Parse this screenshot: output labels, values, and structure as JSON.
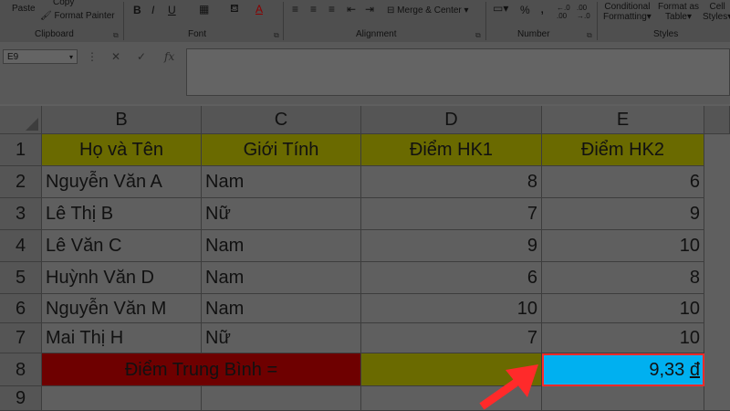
{
  "ribbon": {
    "clipboard": {
      "paste": "Paste",
      "copy": "Copy",
      "format_painter": "Format Painter",
      "group": "Clipboard"
    },
    "font": {
      "bold": "B",
      "italic": "I",
      "underline": "U",
      "font_color": "A",
      "group": "Font"
    },
    "alignment": {
      "merge_center": "Merge & Center",
      "group": "Alignment"
    },
    "number": {
      "percent": "%",
      "comma": ",",
      "group": "Number"
    },
    "styles": {
      "conditional_1": "Conditional",
      "conditional_2": "Formatting",
      "format_table_1": "Format as",
      "format_table_2": "Table",
      "cell_styles_1": "Cell",
      "cell_styles_2": "Styles",
      "group": "Styles"
    }
  },
  "formula_bar": {
    "name_box": "E9",
    "formula": ""
  },
  "columns": [
    "B",
    "C",
    "D",
    "E"
  ],
  "rows": [
    "1",
    "2",
    "3",
    "4",
    "5",
    "6",
    "7",
    "8",
    "9"
  ],
  "sheet": {
    "header": [
      "Họ và Tên",
      "Giới Tính",
      "Điểm HK1",
      "Điểm HK2"
    ],
    "data": [
      [
        "Nguyễn Văn A",
        "Nam",
        "8",
        "6"
      ],
      [
        "Lê Thị B",
        "Nữ",
        "7",
        "9"
      ],
      [
        "Lê Văn C",
        "Nam",
        "9",
        "10"
      ],
      [
        "Huỳnh Văn D",
        "Nam",
        "6",
        "8"
      ],
      [
        "Nguyễn Văn M",
        "Nam",
        "10",
        "10"
      ],
      [
        "Mai Thị H",
        "Nữ",
        "7",
        "10"
      ]
    ],
    "average_label": "Điểm Trung Bình =",
    "average_value": "9,33",
    "currency_symbol": "đ"
  },
  "colors": {
    "selected_cell": "#00b0f0",
    "highlight_border": "#ff2a2a",
    "arrow": "#ff2a2a"
  }
}
